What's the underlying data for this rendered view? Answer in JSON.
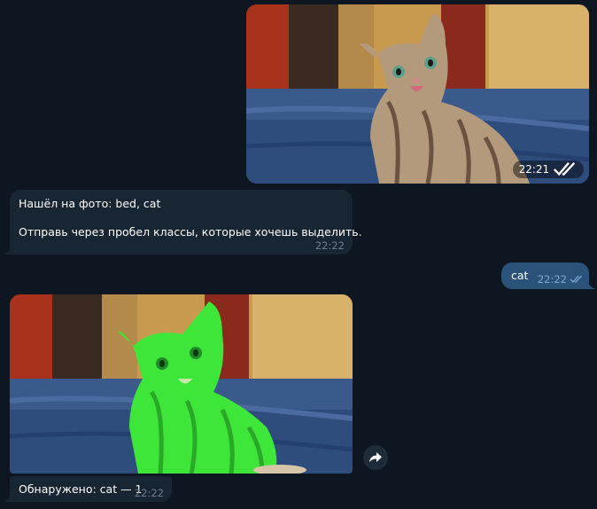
{
  "messages": {
    "photo_out": {
      "time": "22:21",
      "status_icon": "double-check-icon"
    },
    "detected_msg": {
      "line1": "Нашёл на фото: bed, cat",
      "line2": "Отправь через пробел классы, которые хочешь выделить.",
      "time": "22:22"
    },
    "user_msg": {
      "text": "cat",
      "time": "22:22",
      "status_icon": "double-check-icon"
    },
    "photo_in": {
      "action_icon": "forward-icon"
    },
    "result_msg": {
      "text": "Обнаружено: cat — 1",
      "time": "22:22"
    }
  },
  "colors": {
    "background": "#0e1621",
    "incoming_bubble": "#182533",
    "outgoing_bubble": "#2b5278",
    "highlight_mask": "#3ee63a"
  }
}
